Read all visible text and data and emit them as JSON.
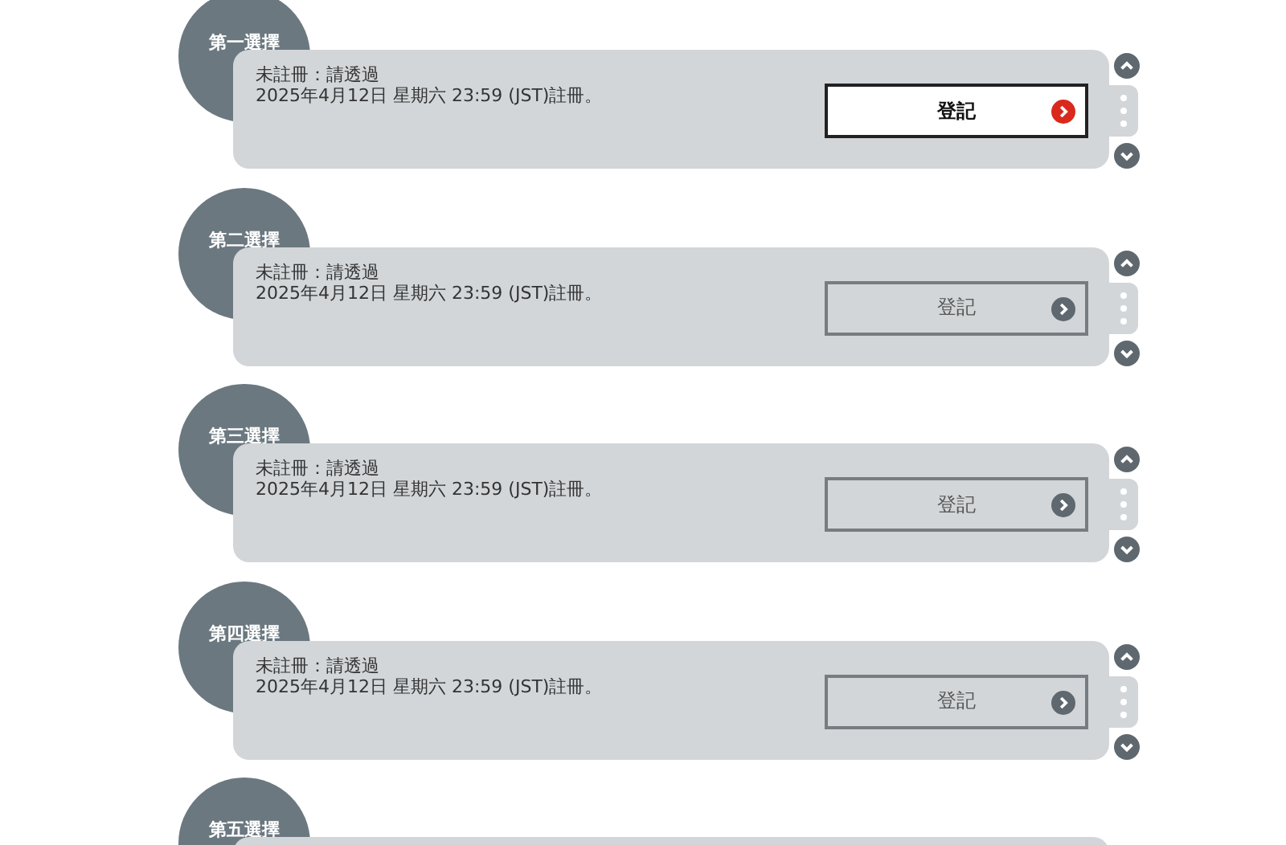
{
  "choices": [
    {
      "label": "第一選擇",
      "status": "未註冊：請透過",
      "deadline": "2025年4月12日 星期六 23:59 (JST)註冊。",
      "button": {
        "label": "登記",
        "selected": true
      }
    },
    {
      "label": "第二選擇",
      "status": "未註冊：請透過",
      "deadline": "2025年4月12日 星期六 23:59 (JST)註冊。",
      "button": {
        "label": "登記",
        "selected": false
      }
    },
    {
      "label": "第三選擇",
      "status": "未註冊：請透過",
      "deadline": "2025年4月12日 星期六 23:59 (JST)註冊。",
      "button": {
        "label": "登記",
        "selected": false
      }
    },
    {
      "label": "第四選擇",
      "status": "未註冊：請透過",
      "deadline": "2025年4月12日 星期六 23:59 (JST)註冊。",
      "button": {
        "label": "登記",
        "selected": false
      }
    },
    {
      "label": "第五選擇"
    }
  ]
}
